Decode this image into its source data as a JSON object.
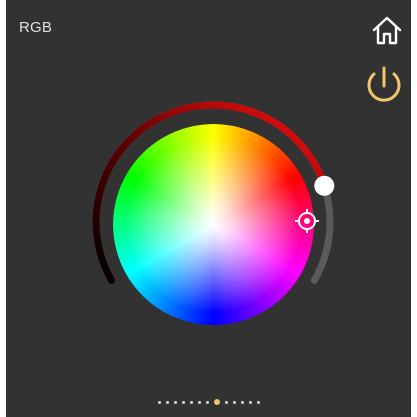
{
  "header": {
    "title": "RGB",
    "home_icon": "home-icon",
    "power_icon": "power-icon"
  },
  "colors": {
    "background": "#323233",
    "power": "#f0c46a",
    "text": "#e0e0e0",
    "active_dot": "#f0c46a",
    "dot": "#d8d8d8"
  },
  "color_wheel": {
    "selector_icon": "crosshair-icon"
  },
  "brightness_ring": {
    "level": 0.8
  },
  "pager": {
    "total": 13,
    "active": 8
  }
}
